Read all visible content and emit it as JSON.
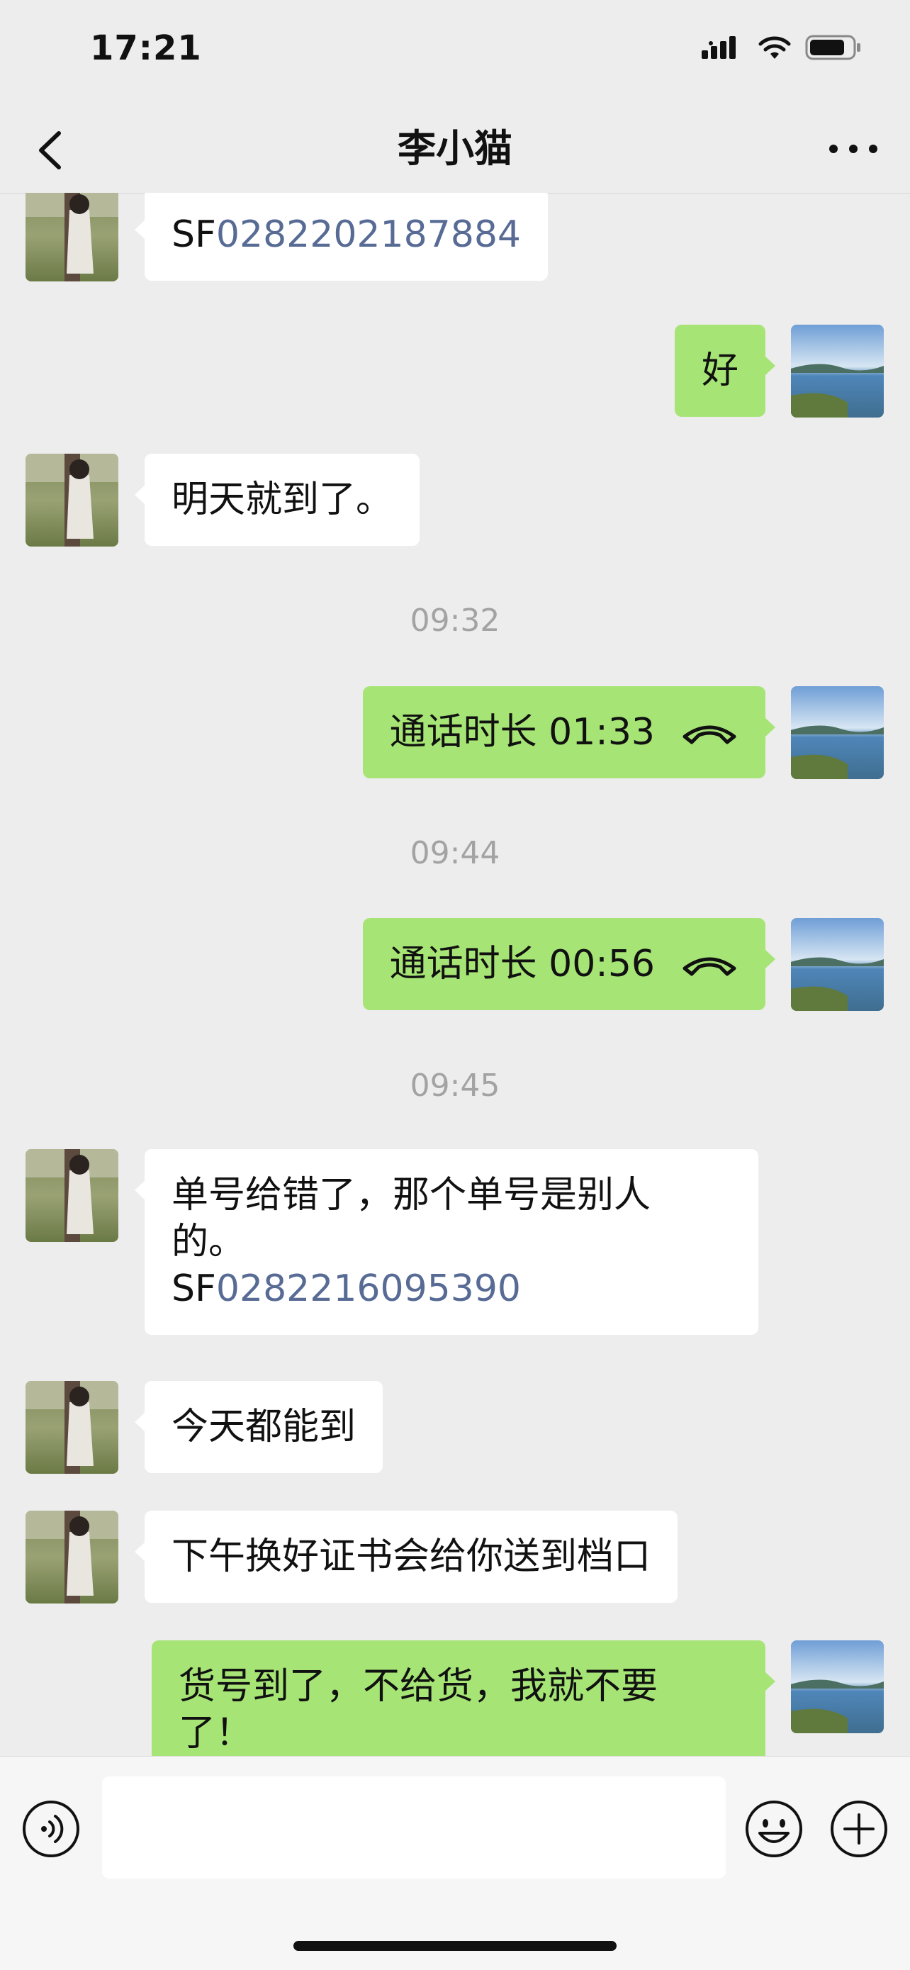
{
  "status_bar": {
    "time": "17:21"
  },
  "nav": {
    "title": "李小猫"
  },
  "messages": {
    "m1": {
      "prefix": "SF",
      "link": "0282202187884"
    },
    "m2": {
      "text": "好"
    },
    "m3": {
      "text": "明天就到了。"
    },
    "t1": "09:32",
    "m4": {
      "text": "通话时长 01:33"
    },
    "t2": "09:44",
    "m5": {
      "text": "通话时长 00:56"
    },
    "t3": "09:45",
    "m6": {
      "line1": "单号给错了，那个单号是别人",
      "line2": "的。",
      "prefix": "SF",
      "link": "0282216095390"
    },
    "m7": {
      "text": "今天都能到"
    },
    "m8": {
      "text": "下午换好证书会给你送到档口"
    },
    "m9": {
      "line1": "货号到了，不给货，我就不要",
      "line2": "了！"
    }
  },
  "colors": {
    "sent_bubble": "#a6e575",
    "received_bubble": "#ffffff",
    "link": "#576b95",
    "background": "#ededed"
  }
}
